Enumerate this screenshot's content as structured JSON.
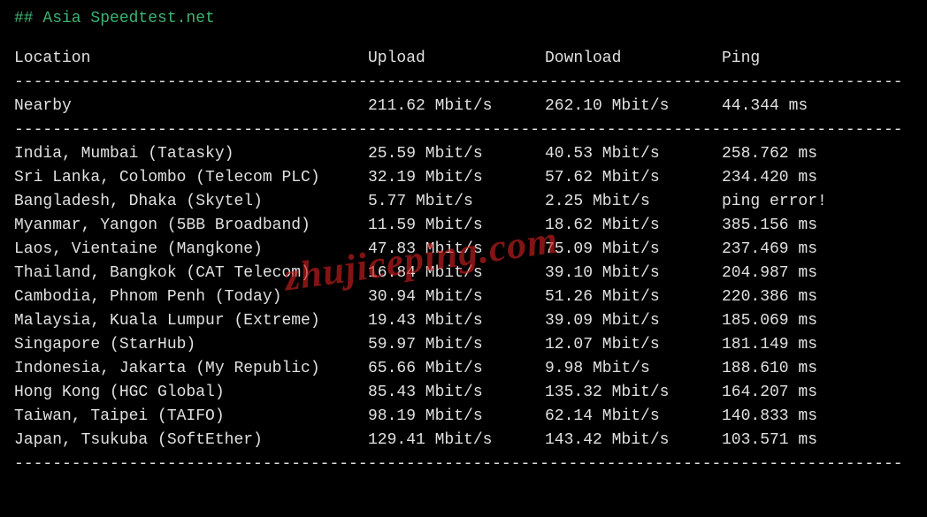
{
  "title": "## Asia Speedtest.net",
  "headers": {
    "location": "Location",
    "upload": "Upload",
    "download": "Download",
    "ping": "Ping"
  },
  "divider": "---------------------------------------------------------------------------------------------",
  "nearby": {
    "location": "Nearby",
    "upload": "211.62 Mbit/s",
    "download": "262.10 Mbit/s",
    "ping": "44.344 ms"
  },
  "rows": [
    {
      "location": "India, Mumbai (Tatasky)",
      "upload": "25.59 Mbit/s",
      "download": "40.53 Mbit/s",
      "ping": "258.762 ms"
    },
    {
      "location": "Sri Lanka, Colombo (Telecom PLC)",
      "upload": "32.19 Mbit/s",
      "download": "57.62 Mbit/s",
      "ping": "234.420 ms"
    },
    {
      "location": "Bangladesh, Dhaka (Skytel)",
      "upload": "5.77 Mbit/s",
      "download": "2.25 Mbit/s",
      "ping": "ping error!"
    },
    {
      "location": "Myanmar, Yangon (5BB Broadband)",
      "upload": "11.59 Mbit/s",
      "download": "18.62 Mbit/s",
      "ping": "385.156 ms"
    },
    {
      "location": "Laos, Vientaine (Mangkone)",
      "upload": "47.83 Mbit/s",
      "download": "75.09 Mbit/s",
      "ping": "237.469 ms"
    },
    {
      "location": "Thailand, Bangkok (CAT Telecom)",
      "upload": "16.84 Mbit/s",
      "download": "39.10 Mbit/s",
      "ping": "204.987 ms"
    },
    {
      "location": "Cambodia, Phnom Penh (Today)",
      "upload": "30.94 Mbit/s",
      "download": "51.26 Mbit/s",
      "ping": "220.386 ms"
    },
    {
      "location": "Malaysia, Kuala Lumpur (Extreme)",
      "upload": "19.43 Mbit/s",
      "download": "39.09 Mbit/s",
      "ping": "185.069 ms"
    },
    {
      "location": "Singapore (StarHub)",
      "upload": "59.97 Mbit/s",
      "download": "12.07 Mbit/s",
      "ping": "181.149 ms"
    },
    {
      "location": "Indonesia, Jakarta (My Republic)",
      "upload": "65.66 Mbit/s",
      "download": "9.98 Mbit/s",
      "ping": "188.610 ms"
    },
    {
      "location": "Hong Kong (HGC Global)",
      "upload": "85.43 Mbit/s",
      "download": "135.32 Mbit/s",
      "ping": "164.207 ms"
    },
    {
      "location": "Taiwan, Taipei (TAIFO)",
      "upload": "98.19 Mbit/s",
      "download": "62.14 Mbit/s",
      "ping": "140.833 ms"
    },
    {
      "location": "Japan, Tsukuba (SoftEther)",
      "upload": "129.41 Mbit/s",
      "download": "143.42 Mbit/s",
      "ping": "103.571 ms"
    }
  ],
  "watermark": "zhujiceping.com"
}
